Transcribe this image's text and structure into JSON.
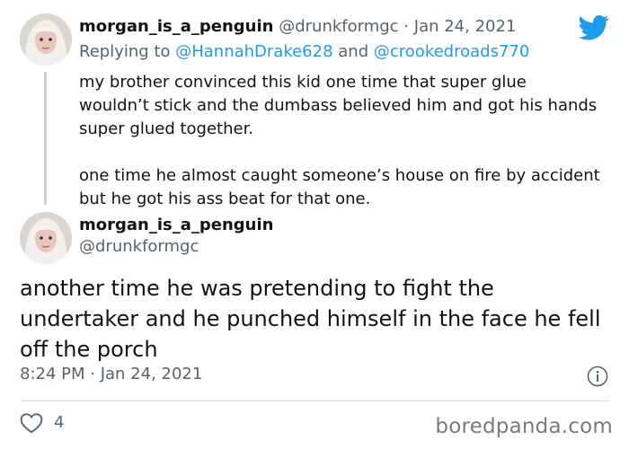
{
  "tweet1": {
    "display_name": "morgan_is_a_penguin",
    "handle": "@drunkformgc",
    "separator": "·",
    "date": "Jan 24, 2021",
    "reply_prefix": "Replying to",
    "reply_user1": "@HannahDrake628",
    "reply_conj": "and",
    "reply_user2": "@crookedroads770",
    "paragraph1": "my brother convinced this kid one time that super glue wouldn’t stick and the dumbass believed him and got his hands super glued together.",
    "paragraph2": "one time he almost caught someone’s house on fire by accident but he got his ass beat for that one."
  },
  "tweet2": {
    "display_name": "morgan_is_a_penguin",
    "handle": "@drunkformgc",
    "text": "another time he was pretending to fight the undertaker and he punched himself in the face he fell off the porch",
    "timestamp": "8:24 PM · Jan 24, 2021",
    "like_count": "4"
  },
  "icons": {
    "logo": "twitter-bird-icon",
    "info": "info-icon",
    "like": "heart-icon"
  },
  "colors": {
    "brand_blue": "#1d9bf0",
    "muted_text": "#536471",
    "thread_line": "#c4cfd6"
  },
  "watermark": "boredpanda.com"
}
